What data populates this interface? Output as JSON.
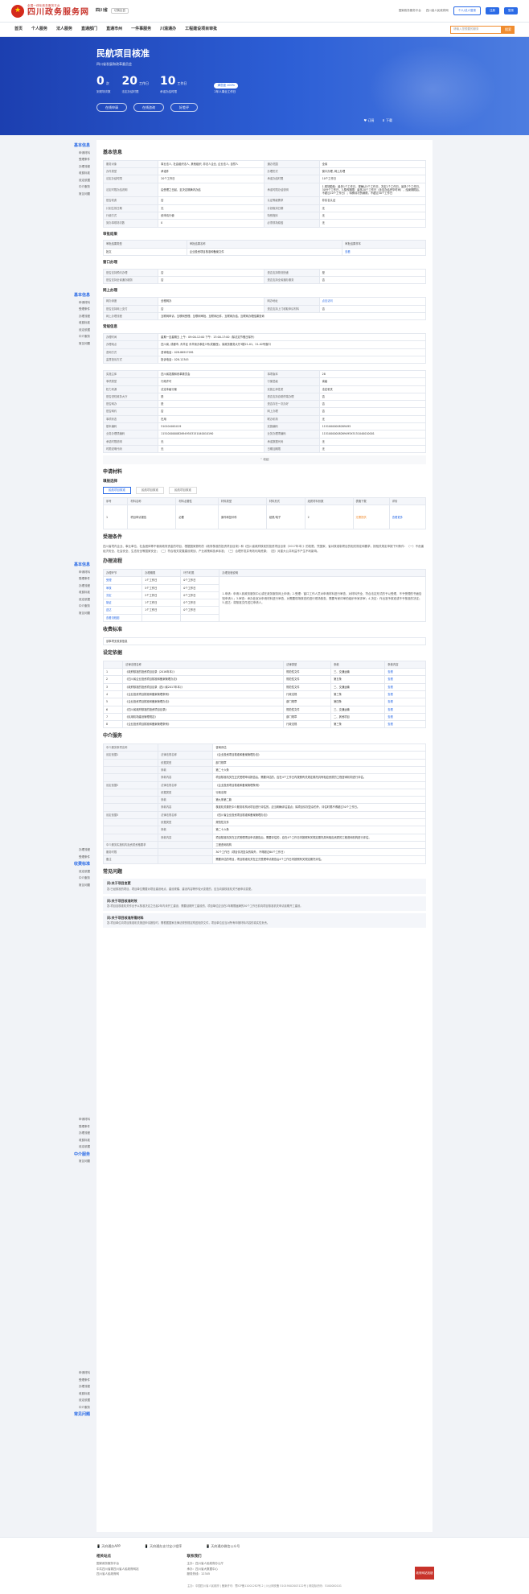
{
  "header": {
    "logo_sub": "全国一体化政务服务平台",
    "logo_main": "四川政务服务网",
    "region": "四川省",
    "region_switch": "切换区县",
    "links": [
      "国家政务服务平台",
      "四川省人民政府网"
    ],
    "login_personal": "个人/法人登录",
    "register": "注册",
    "enterprise": "登录"
  },
  "nav": {
    "items": [
      "首页",
      "个人服务",
      "法人服务",
      "直通部门",
      "直通市州",
      "一件事服务",
      "川渝通办",
      "工程建设项目审批"
    ],
    "search_placeholder": "请输入您想要的服务",
    "search_btn": "搜索"
  },
  "banner": {
    "title": "民航项目核准",
    "dept": "四川省发展和改革委员会",
    "stats": [
      {
        "num": "0",
        "unit": "次",
        "lbl": "到现场次数"
      },
      {
        "num": "20",
        "unit": "工作日",
        "lbl": "法定办结时限"
      },
      {
        "num": "10",
        "unit": "工作日",
        "lbl": "承诺办结时限"
      }
    ],
    "satisfaction": "满意度 100%",
    "satisfaction_lbl": "2年人事业工作日",
    "btns": [
      "在线申请",
      "在线咨询",
      "好差评"
    ],
    "actions": [
      "订阅",
      "下载"
    ]
  },
  "side": {
    "g1": {
      "h": "基本信息",
      "items": [
        "申请材料",
        "受理条件",
        "办理流程",
        "收费标准",
        "设定依据",
        "中介服务",
        "常见问题"
      ]
    },
    "g2": {
      "h": "基本信息",
      "items": [
        "申请材料",
        "受理条件",
        "办理流程",
        "收费标准",
        "设定依据",
        "中介服务",
        "常见问题"
      ]
    },
    "g3": {
      "h": "基本信息",
      "items": [
        "申请材料",
        "受理条件",
        "办理流程",
        "收费标准",
        "设定依据",
        "中介服务",
        "常见问题"
      ]
    },
    "g4": {
      "h": "收费标准",
      "items": [
        "设定依据",
        "中介服务",
        "常见问题"
      ]
    },
    "g5": {
      "h": "中介服务",
      "items": [
        "常见问题"
      ]
    },
    "g6": {
      "h": "常见问题",
      "items": []
    }
  },
  "basic": {
    "title": "基本信息",
    "rows": [
      [
        "服务对象",
        "事业法人, 社会组织法人, 其他组织, 非法人企业, 企业法人, 自然人",
        "通办范围",
        "全省"
      ],
      [
        "办件类型",
        "承诺件",
        "办理形式",
        "窗口办理, 网上办理"
      ],
      [
        "法定办结时限",
        "20个工作日",
        "承诺办结时限",
        "10个工作日"
      ],
      [
        "法定时限办结说明",
        "由受理之日起，至决定期满内办结",
        "承诺时限办结说明",
        "1.现场勘验：最多1个工作日，视确认5个工作日，决定1个工作日，最多7个工作日，30分个工作日，3.整改期限：最多20个工作日（含至办结完毕时间），结案期限后，不超过10个工作日）；特殊情况的期限，不超过30个工作日"
      ],
      [
        "是否收费",
        "否",
        "认证等级需求",
        "非实名认证"
      ],
      [
        "计划生效日期",
        "无",
        "计划取消日期",
        "无"
      ],
      [
        "行使方式",
        "依申请行使",
        "特别程序",
        "无"
      ],
      [
        "到办事现场次数",
        "0",
        "必须现场原因",
        "无"
      ]
    ]
  },
  "review": {
    "title": "审批结果",
    "headers": [
      "审批结果类型",
      "审批结果名称",
      "审批结果样本"
    ],
    "row": [
      "批文",
      "企业投资项目核准和备案文件",
      "查看"
    ]
  },
  "window": {
    "title": "窗口办理",
    "rows": [
      [
        "是否支持预约办理",
        "否",
        "是否支持物流快递",
        "是"
      ],
      [
        "是否支持全省通办服务",
        "否",
        "是否支持全省通办服务",
        "否"
      ]
    ]
  },
  "online": {
    "title": "网上办理",
    "rows": [
      [
        "网办深度",
        "全程网办",
        "网办地址",
        "点击访问"
      ],
      [
        "是否支持网上支付",
        "否",
        "是否支持上门收取申请材料",
        "否"
      ],
      [
        "网上办理流程",
        "互联网申请、互联网受理、互联网审批、互联网出件、互联网办结、互联网办理结果查询",
        "",
        ""
      ]
    ]
  },
  "common": {
    "title": "常规信息",
    "rows": [
      [
        "办理时间",
        "星期一至星期五 上午：09:00-12:00 下午：13:00-17:00（除法定节假日除外）"
      ],
      [
        "办理地点",
        "四川省, 成都市, 青羊区 青羊街办事处1号(成都西)，省政务服务大厅3楼21-01、21-02号窗口"
      ],
      [
        "咨询方式",
        "咨询电话：028-86917091"
      ],
      [
        "监督投诉方式",
        "投诉电话：028-12345"
      ]
    ]
  },
  "extra": {
    "rows": [
      [
        "实施主体",
        "四川省发展和改革委员会",
        "事项版本",
        "28"
      ],
      [
        "事项类型",
        "行政许可",
        "行使层级",
        "省级"
      ],
      [
        "权力来源",
        "法定本级行使",
        "实施主体性质",
        "法定机关"
      ],
      [
        "是否进驻政务大厅",
        "是",
        "是否支持自助终端办理",
        "否"
      ],
      [
        "是否网办",
        "是",
        "是否存在一次办好",
        "否"
      ],
      [
        "是否网约",
        "否",
        "网上办理",
        "否"
      ],
      [
        "事项状态",
        "在用",
        "联办机构",
        "无"
      ],
      [
        "基本编码",
        "510104001019",
        "实施编码",
        "11510000008269495"
      ],
      [
        "业务办理项编码",
        "11510000008269495X3151040010190",
        "业务办理项编码",
        "11510000008269495X5151040010001"
      ],
      [
        "承诺时限说明",
        "无",
        "承诺数据代码",
        "无"
      ],
      [
        "时限说明代码",
        "无",
        "日期加期限",
        "无"
      ]
    ],
    "collapse": "收起"
  },
  "materials": {
    "title": "申请材料",
    "sub": "填报选择",
    "tabs": [
      "民航项目核准",
      "民航项目核准",
      "民航项目核准"
    ],
    "headers": [
      "序号",
      "材料名称",
      "材料必要性",
      "材料类型",
      "材料形式",
      "纸质材料份数",
      "表格下载",
      "详情"
    ],
    "row": [
      "1",
      "项目申请报告",
      "必要",
      "原件和复印件",
      "纸质/电子",
      "2",
      "无需提供",
      "查看更多"
    ]
  },
  "acceptance": {
    "title": "受理条件",
    "text": "四川省境内企业、事业单位、社会团体等不使用政府资金的项目，根据国家颁布的《政府核准的投资项目目录》和《四川省政府核准的投资项目目录（2017年本）》的权限，凭国家、省对核准制项目的相关规定和要求，按相关规定申报下列条件：（一）不危害经济安全、社会安全、生态安全等国家安全；（二）符合相关发展建设规划、产业政策和技术标准；（三）合理开发并有效利用资源；（四）对重大公共利益不产生不利影响。"
  },
  "process": {
    "title": "办理流程",
    "headers": [
      "办理环节",
      "办理期限",
      "环节时限",
      "办理流程说明"
    ],
    "steps": [
      [
        "受理",
        "1个工作日",
        "0个工作日"
      ],
      [
        "审核",
        "5个工作日",
        "0个工作日"
      ],
      [
        "决定",
        "2个工作日",
        "0个工作日"
      ],
      [
        "制证",
        "1个工作日",
        "0个工作日"
      ],
      [
        "送达",
        "1个工作日",
        "0个工作日"
      ],
      [
        "查看流程图",
        "",
        ""
      ]
    ],
    "desc": "1.申请：申请人到政务服务中心或在政务服务网上申请；2.受理：窗口工作人员对申请材料进行审查，对材料齐全、符合法定形式的予以受理，不予受理的书面告知申请人；3.审查：承办处室对申请材料进行审查，对需要现场核查的进行现场核查，需要专家评审的组织专家评审；4.决定：作出准予核准或不予核准的决定；5.送达：将核准文件送达申请人。"
  },
  "fee": {
    "title": "收费标准",
    "text": "该事项无收费信息"
  },
  "basis": {
    "title": "设定依据",
    "headers": [
      "法律法规名称",
      "法律类型",
      "条款",
      "条款内容"
    ],
    "rows": [
      [
        "1",
        "《政府核准的投资项目目录（2016年本）》",
        "规范性文件",
        "三、交通运输",
        "查看"
      ],
      [
        "2",
        "《四川省企业投资项目核准和备案管理办法》",
        "规范性文件",
        "第五条",
        "查看"
      ],
      [
        "3",
        "《政府核准的投资项目目录（四川省2017年本）》",
        "规范性文件",
        "三、交通运输",
        "查看"
      ],
      [
        "4",
        "《企业投资项目核准和备案管理条例》",
        "行政法规",
        "第三条",
        "查看"
      ],
      [
        "5",
        "《企业投资项目核准和备案管理办法》",
        "部门规章",
        "第四条",
        "查看"
      ],
      [
        "6",
        "《四川省政府核准的投资项目目录》",
        "规范性文件",
        "三、交通运输",
        "查看"
      ],
      [
        "7",
        "《民用机场建设管理规定》",
        "部门规章",
        "二、其他项目",
        "查看"
      ],
      [
        "8",
        "《企业投资项目核准和备案管理条例》",
        "行政法规",
        "第三条",
        "查看"
      ]
    ]
  },
  "intermediary": {
    "title": "中介服务",
    "rows": [
      [
        "中介服务事项名称",
        "",
        "咨询评估"
      ],
      [
        "设定依据1",
        "法律法规名称",
        "《企业投资项目核准和备案管理办法》"
      ],
      [
        "",
        "依据类型",
        "部门规章"
      ],
      [
        "",
        "条款",
        "第二十六条"
      ],
      [
        "",
        "条款内容",
        "项目核准机关在正式受理申请报告后，需要评估的，应在4个工作日内按照有关规定委托具有相应资质的工程咨询机构进行评估。"
      ],
      [
        "设定依据2",
        "法律法规名称",
        "《企业投资项目核准和备案管理条例》"
      ],
      [
        "",
        "依据类型",
        "行政法规"
      ],
      [
        "",
        "条款",
        "第九条第二款"
      ],
      [
        "",
        "条款内容",
        "核准机关委托中介服务机构对项目进行评估的，应当明确评估重点；除项目情况复杂的外，评估时限不得超过30个工作日。"
      ],
      [
        "设定依据3",
        "法律法规名称",
        "《四川省企业投资项目核准和备案管理办法》"
      ],
      [
        "",
        "依据类型",
        "规范性文件"
      ],
      [
        "",
        "条款",
        "第二十六条"
      ],
      [
        "",
        "条款内容",
        "项目核准机关在正式受理项目申请报告后，需要评估的，应在4个工作日内按照有关规定委托具有相应资质的工程咨询机构进行评估。"
      ],
      [
        "中介服务实施机构及资质资格要求",
        "",
        "工程咨询机构"
      ],
      [
        "服务时限",
        "",
        "30个工作日（项目情况复杂的除外，不得超过60个工作日）"
      ],
      [
        "备注",
        "",
        "需要评估的项目，项目核准机关在正式受理申请报告后4个工作日内按照有关规定委托评估。"
      ]
    ]
  },
  "faq": {
    "title": "常见问题",
    "items": [
      {
        "q": "问:关于项目变更",
        "a": "答:已经核准的项目，项目单位需要对项目建设地点、建设规模、建设内容等作较大变更的，应当向原核准机关书面申请变更。"
      },
      {
        "q": "问:关于项目核准时效",
        "a": "答:项目自核准机关作出予以核准决定之日起2年内未开工建设，需要延期开工建设的，项目单位应当在2年期限届满的30个工作日前向项目核准机关申请延期开工建设。"
      },
      {
        "q": "问:关于项目核准所需材料",
        "a": "答:项目单位向项目核准机关报送申请报告时，需根据国家法律法规的规定附送相关文件，项目单位应当对所有申报材料内容的真实性负责。"
      }
    ]
  },
  "footer": {
    "apps": [
      "天府通办APP",
      "天府通办支付宝小程序",
      "天府通办微信公众号"
    ],
    "related_h": "相关站点",
    "related": [
      "国家政务服务平台",
      "中共四川省委四川省人民政府网站",
      "四川省人民政府网"
    ],
    "contact_h": "联系我们",
    "contact": [
      "主办：四川省人民政府办公厅",
      "承办：四川省大数据中心",
      "服务热线：12345"
    ],
    "badge": "政府网站找错",
    "bottom": "主办：中国四川省人民政府 | 备案许可：蜀ICP备11001282号-2 | 川公网安备 51019002003122号 | 网站标识码：5100000101"
  }
}
